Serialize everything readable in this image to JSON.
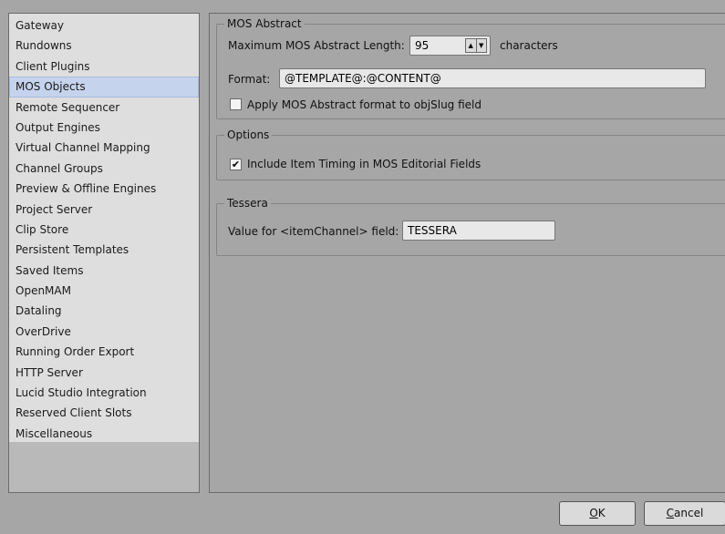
{
  "sidebar": {
    "items": [
      {
        "label": "Gateway"
      },
      {
        "label": "Rundowns"
      },
      {
        "label": "Client Plugins"
      },
      {
        "label": "MOS Objects",
        "selected": true
      },
      {
        "label": "Remote Sequencer"
      },
      {
        "label": "Output Engines"
      },
      {
        "label": "Virtual Channel Mapping"
      },
      {
        "label": "Channel Groups"
      },
      {
        "label": "Preview & Offline Engines"
      },
      {
        "label": "Project Server"
      },
      {
        "label": "Clip Store"
      },
      {
        "label": "Persistent Templates"
      },
      {
        "label": "Saved Items"
      },
      {
        "label": "OpenMAM"
      },
      {
        "label": "Dataling"
      },
      {
        "label": "OverDrive"
      },
      {
        "label": "Running Order Export"
      },
      {
        "label": "HTTP Server"
      },
      {
        "label": "Lucid Studio Integration"
      },
      {
        "label": "Reserved Client Slots"
      },
      {
        "label": "Miscellaneous"
      }
    ]
  },
  "mos_abstract": {
    "title": "MOS Abstract",
    "max_length_label": "Maximum MOS Abstract Length:",
    "max_length_value": "95",
    "characters_label": "characters",
    "format_label": "Format:",
    "format_value": "@TEMPLATE@:@CONTENT@",
    "apply_label": "Apply MOS Abstract format to objSlug field",
    "apply_checked": false
  },
  "options": {
    "title": "Options",
    "timing_label": "Include Item Timing in MOS Editorial Fields",
    "timing_checked": true
  },
  "tessera": {
    "title": "Tessera",
    "channel_label": "Value for <itemChannel> field:",
    "channel_value": "TESSERA"
  },
  "buttons": {
    "ok_mnemonic": "O",
    "ok_rest": "K",
    "cancel_mnemonic": "C",
    "cancel_rest": "ancel"
  },
  "icons": {
    "checkmark": "check-icon",
    "spin_up": "triangle-up-icon",
    "spin_down": "triangle-down-icon"
  }
}
